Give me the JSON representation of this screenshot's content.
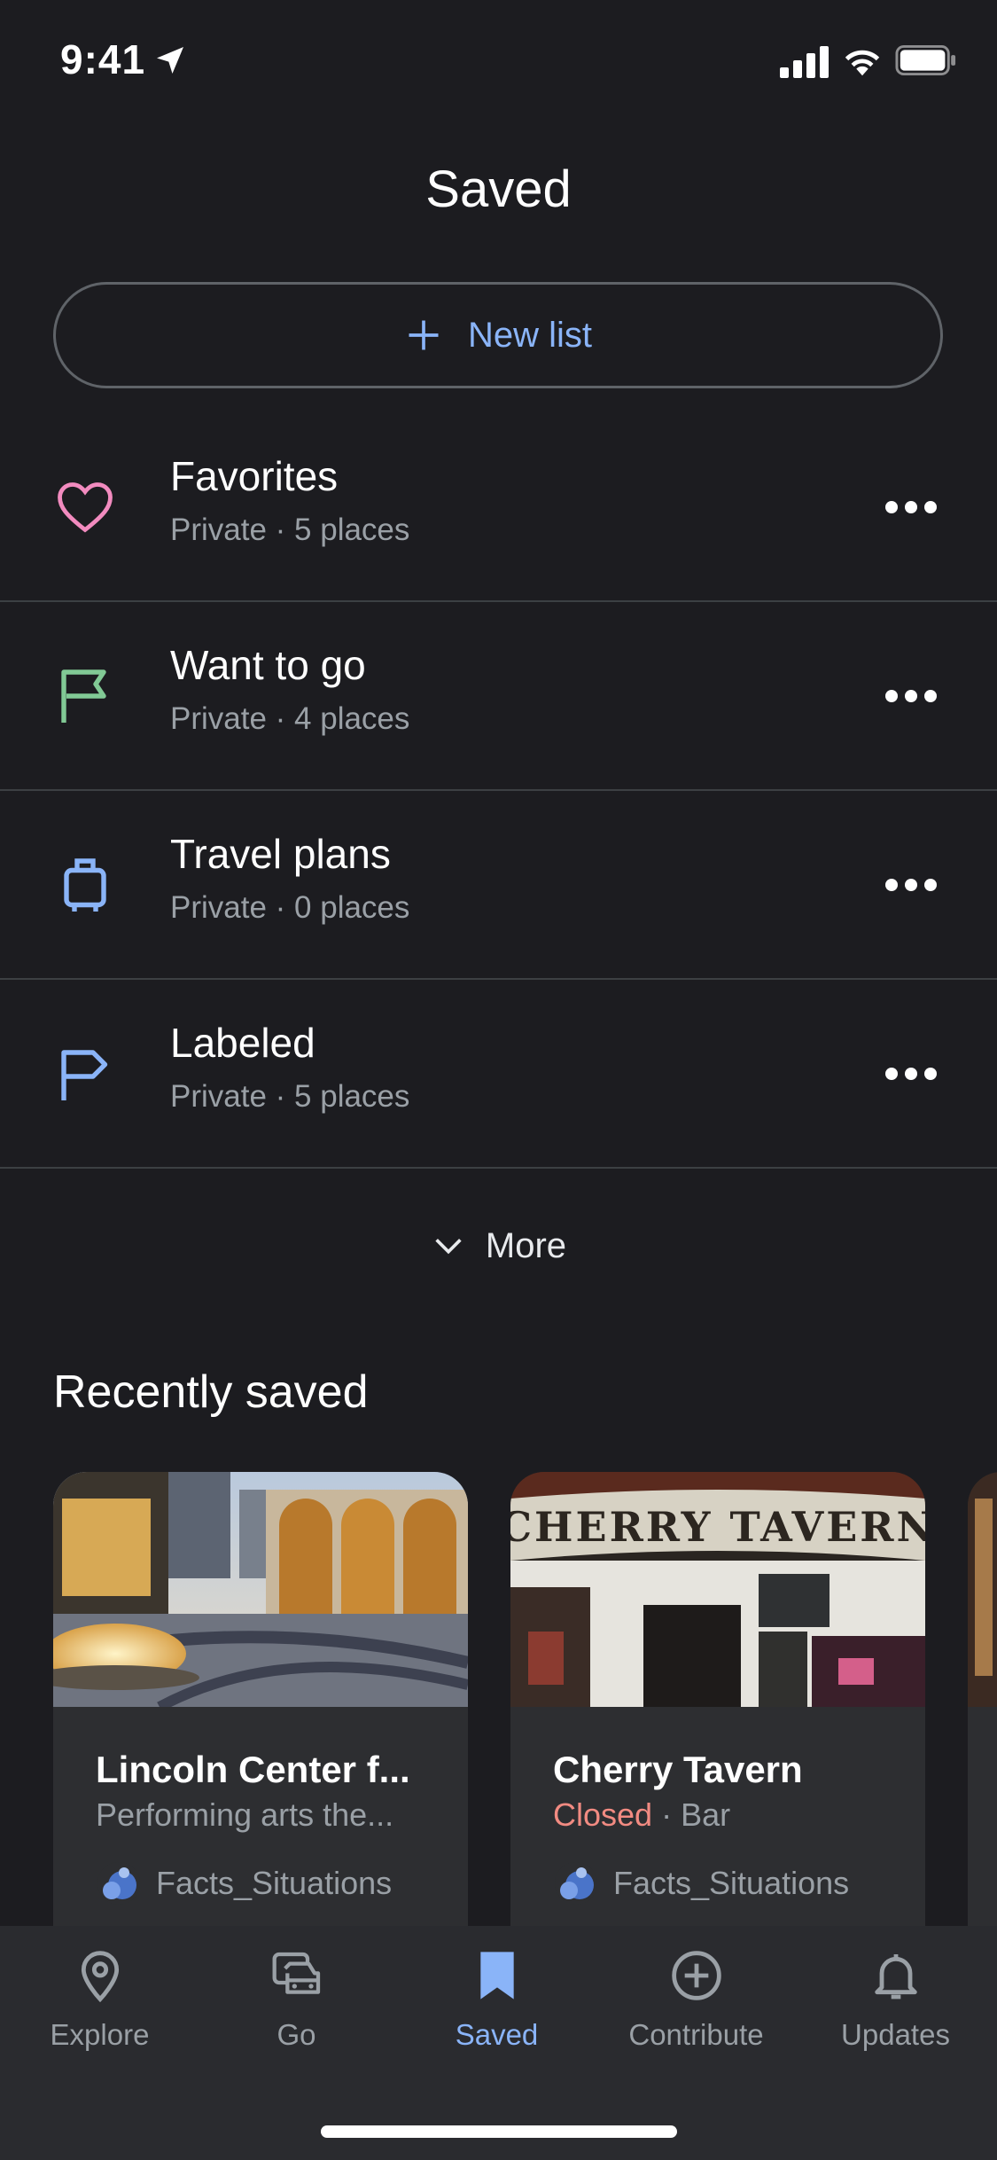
{
  "status_bar": {
    "time": "9:41"
  },
  "header": {
    "title": "Saved"
  },
  "new_list": {
    "label": "New list"
  },
  "lists": [
    {
      "name": "Favorites",
      "meta": "Private · 5 places",
      "icon": "heart-icon",
      "color": "#f28bbf"
    },
    {
      "name": "Want to go",
      "meta": "Private · 4 places",
      "icon": "flag-icon",
      "color": "#81c995"
    },
    {
      "name": "Travel plans",
      "meta": "Private · 0 places",
      "icon": "suitcase-icon",
      "color": "#8ab4f8"
    },
    {
      "name": "Labeled",
      "meta": "Private · 5 places",
      "icon": "label-flag-icon",
      "color": "#8ab4f8"
    }
  ],
  "more": {
    "label": "More"
  },
  "recently_saved": {
    "title": "Recently saved",
    "cards": [
      {
        "name": "Lincoln Center f...",
        "subtitle": "Performing arts the...",
        "user": "Facts_Situations"
      },
      {
        "name": "Cherry Tavern",
        "status": "Closed",
        "category": "· Bar",
        "user": "Facts_Situations",
        "sign_text": "CHERRY TAVERN"
      }
    ]
  },
  "bottom_nav": [
    {
      "label": "Explore",
      "icon": "location-pin-icon"
    },
    {
      "label": "Go",
      "icon": "car-icon"
    },
    {
      "label": "Saved",
      "icon": "bookmark-icon",
      "active": true
    },
    {
      "label": "Contribute",
      "icon": "add-circle-icon"
    },
    {
      "label": "Updates",
      "icon": "bell-icon"
    }
  ],
  "colors": {
    "accent": "#8ab4f8",
    "background": "#1c1c20",
    "closed": "#f28b82"
  }
}
